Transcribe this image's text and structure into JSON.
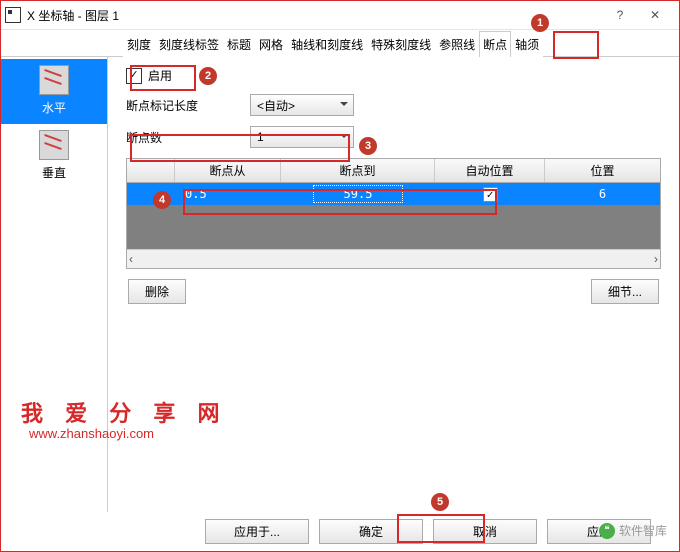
{
  "window": {
    "title": "X 坐标轴 - 图层 1",
    "help": "?",
    "minimize": "",
    "close": "✕"
  },
  "tabs": [
    "刻度",
    "刻度线标签",
    "标题",
    "网格",
    "轴线和刻度线",
    "特殊刻度线",
    "参照线",
    "断点",
    "轴须"
  ],
  "active_tab_index": 7,
  "sidebar": {
    "items": [
      {
        "label": "水平"
      },
      {
        "label": "垂直"
      }
    ],
    "active_index": 0
  },
  "panel": {
    "enable": {
      "checked": true,
      "label": "启用"
    },
    "marker_len": {
      "label": "断点标记长度",
      "value": "<自动>"
    },
    "count": {
      "label": "断点数",
      "value": "1"
    },
    "table": {
      "headers": [
        "",
        "断点从",
        "断点到",
        "自动位置",
        "位置"
      ],
      "row": {
        "from": "0.5",
        "to": "59.5",
        "auto": true,
        "pos": "6"
      }
    },
    "delete_btn": "删除",
    "detail_btn": " 细节..."
  },
  "footer": {
    "apply_to": "应用于...",
    "ok": "确定",
    "cancel": "取消",
    "apply": "应用"
  },
  "badges": {
    "b1": "1",
    "b2": "2",
    "b3": "3",
    "b4": "4",
    "b5": "5"
  },
  "watermark": {
    "line1": "我 爱 分 享 网",
    "line2": "www.zhanshaoyi.com",
    "corner": "软件智库"
  }
}
